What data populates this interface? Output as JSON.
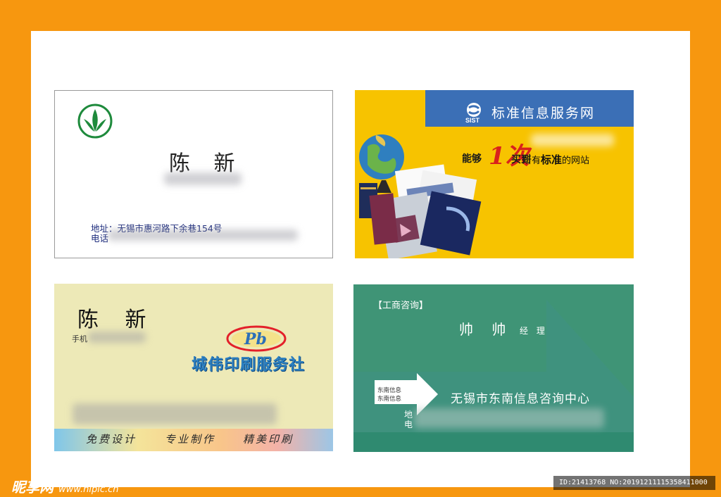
{
  "card1": {
    "name": "陈 新",
    "address": "地址：无锡市惠河路下余巷154号",
    "tel_label": "电话",
    "logo_color": "#1e8a3c"
  },
  "card2": {
    "brand": "SIST",
    "title": "标准信息服务网",
    "slogan_prefix": "能够",
    "slogan_big": "1次",
    "slogan_mid": "买到",
    "slogan_text1": "所有",
    "slogan_bold": "标准",
    "slogan_text2": "的网站",
    "band_color": "#3b6fb6",
    "bg_color": "#f7c300"
  },
  "card3": {
    "name": "陈 新",
    "mobile_label": "手机",
    "logo_text": "Pb",
    "company": "城伟印刷服务社",
    "slogans": [
      "免费设计",
      "专业制作",
      "精美印刷"
    ]
  },
  "card4": {
    "category": "【工商咨询】",
    "name": "帅 帅",
    "role": "经 理",
    "company": "无锡市东南信息咨询中心",
    "small_text_1": "东南信息",
    "small_text_2": "东南信息",
    "address_label": "地",
    "tel_label": "电",
    "bg_color": "#3f9476"
  },
  "watermark": {
    "brand": "昵享网",
    "url": "www.nipic.cn",
    "id": "ID:21413768 NO:20191211115358411000"
  }
}
